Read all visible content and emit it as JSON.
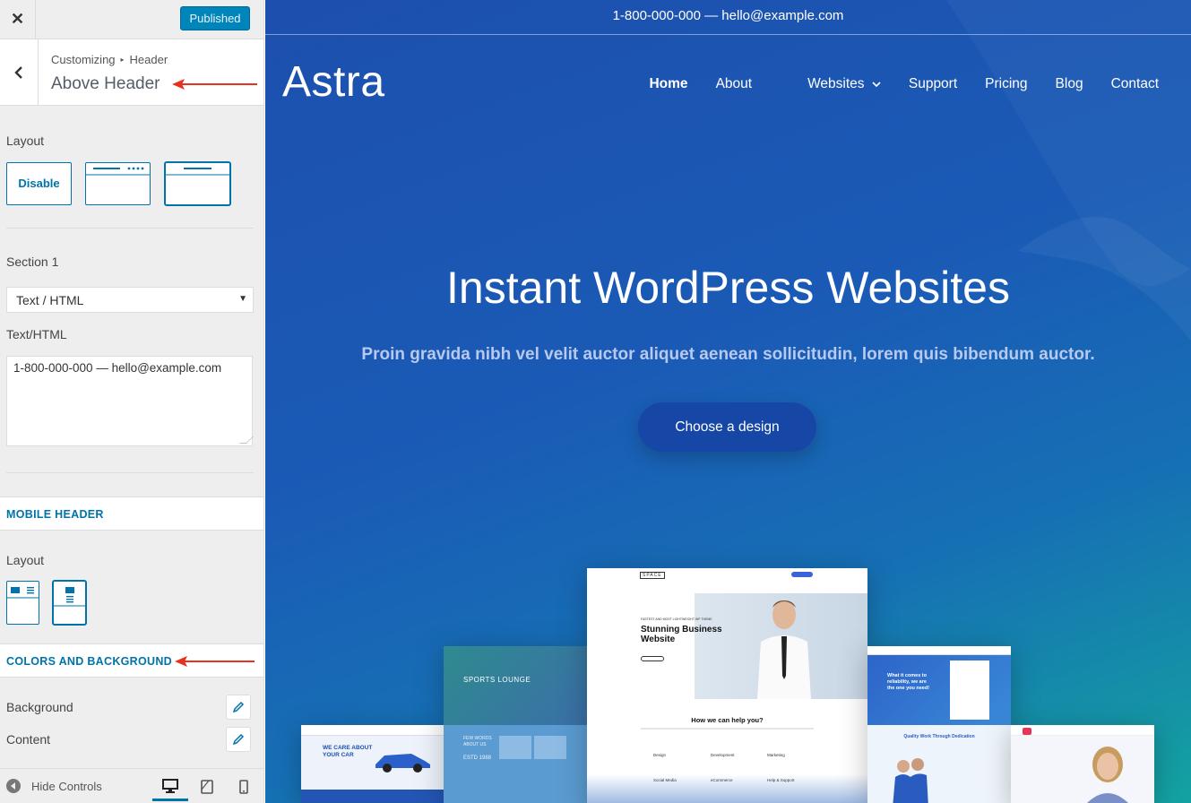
{
  "topbar": {
    "close_label": "✕",
    "publish_label": "Published"
  },
  "panel": {
    "breadcrumb_root": "Customizing",
    "breadcrumb_sep": "▸",
    "breadcrumb_parent": "Header",
    "title": "Above Header"
  },
  "layout": {
    "label": "Layout",
    "disable_label": "Disable"
  },
  "section1": {
    "label": "Section 1",
    "select_value": "Text / HTML",
    "text_label": "Text/HTML",
    "text_value": "1-800-000-000 — hello@example.com"
  },
  "mobile_header": {
    "heading": "MOBILE HEADER",
    "layout_label": "Layout"
  },
  "colors": {
    "heading": "COLORS AND BACKGROUND",
    "background_label": "Background",
    "content_label": "Content"
  },
  "footer": {
    "hide_controls_label": "Hide Controls"
  },
  "preview": {
    "above_header_text": "1-800-000-000 — hello@example.com",
    "logo": "Astra",
    "nav": [
      "Home",
      "About",
      "Websites",
      "Support",
      "Pricing",
      "Blog",
      "Contact"
    ],
    "hero_title": "Instant WordPress Websites",
    "hero_subtitle": "Proin gravida nibh vel velit auctor aliquet aenean sollicitudin, lorem quis bibendum auctor.",
    "cta_label": "Choose a design",
    "mockups": {
      "center_logo": "SPACE",
      "center_kicker": "FASTEST AND MOST LIGHTWEIGHT WP THEME",
      "center_title_1": "Stunning Business",
      "center_title_2": "Website",
      "center_section": "How we can help you?",
      "services": [
        "Design",
        "Development",
        "Marketing",
        "Social Media",
        "eCommerce",
        "Help & Support"
      ],
      "sports_title": "SPORTS LOUNGE",
      "sports_sub": "FEW WORDS ABOUT US",
      "sports_year": "ESTD 1988",
      "car_title_1": "WE CARE ABOUT",
      "car_title_2": "YOUR CAR",
      "right_tagline": "What it comes to reliability, we are the one you need!",
      "right_section": "Quality Work Through Dedication"
    }
  },
  "colors_palette": {
    "accent": "#0073aa",
    "button": "#0085ba",
    "cta": "#1747a6",
    "arrow": "#e8321f"
  }
}
